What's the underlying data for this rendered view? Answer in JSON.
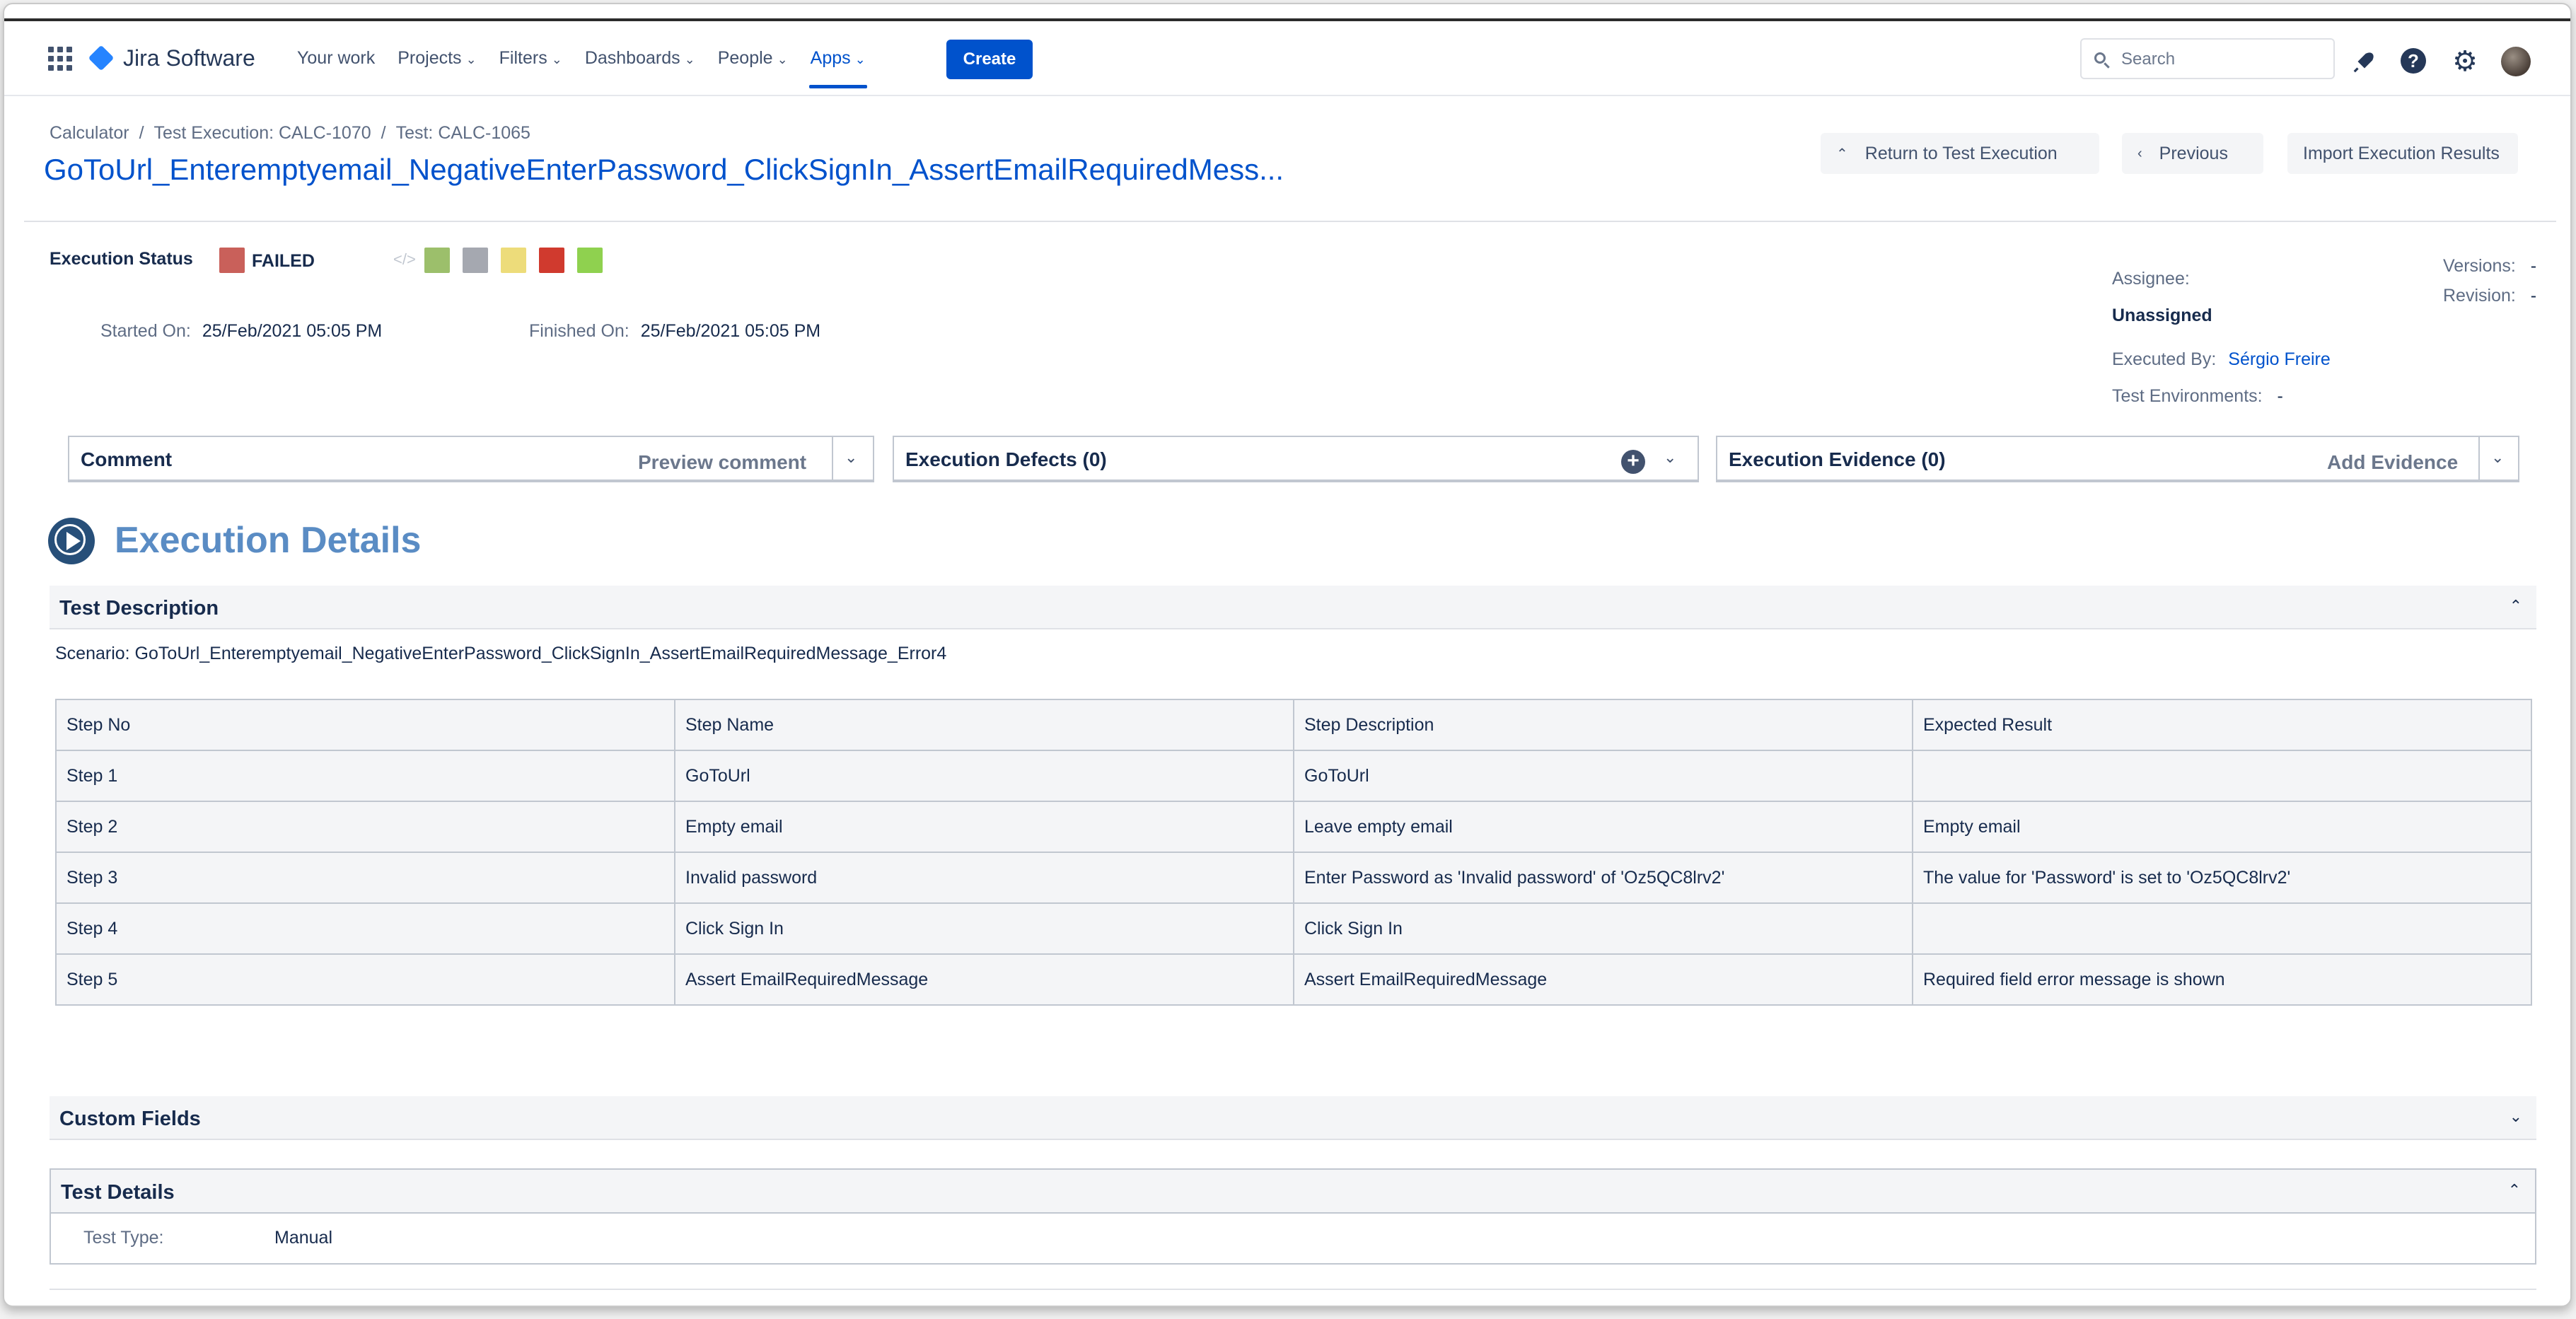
{
  "header": {
    "product_name": "Jira Software",
    "nav": [
      {
        "label": "Your work",
        "dropdown": false,
        "active": false
      },
      {
        "label": "Projects",
        "dropdown": true,
        "active": false
      },
      {
        "label": "Filters",
        "dropdown": true,
        "active": false
      },
      {
        "label": "Dashboards",
        "dropdown": true,
        "active": false
      },
      {
        "label": "People",
        "dropdown": true,
        "active": false
      },
      {
        "label": "Apps",
        "dropdown": true,
        "active": true
      }
    ],
    "create_label": "Create",
    "search_placeholder": "Search",
    "icons": [
      "apps-grid-icon",
      "bell-icon",
      "help-icon",
      "gear-icon",
      "avatar"
    ]
  },
  "breadcrumb": [
    "Calculator",
    "Test Execution: CALC-1070",
    "Test: CALC-1065"
  ],
  "page_title": "GoToUrl_Enteremptyemail_NegativeEnterPassword_ClickSignIn_AssertEmailRequiredMess...",
  "actions": {
    "return_label": "Return to Test Execution",
    "previous_label": "Previous",
    "import_label": "Import Execution Results"
  },
  "execution": {
    "status_label": "Execution Status",
    "status_value": "FAILED",
    "status_color": "#c9605a",
    "step_colors": [
      "#9cbf6b",
      "#a5a8b0",
      "#eddc7a",
      "#d03a2e",
      "#8fd14f"
    ],
    "started_label": "Started On:",
    "started_value": "25/Feb/2021 05:05 PM",
    "finished_label": "Finished On:",
    "finished_value": "25/Feb/2021 05:05 PM"
  },
  "people": {
    "assignee_label": "Assignee:",
    "assignee_value": "Unassigned",
    "executed_by_label": "Executed By:",
    "executed_by_value": "Sérgio Freire",
    "test_env_label": "Test Environments:",
    "test_env_value": "-",
    "versions_label": "Versions:",
    "versions_value": "-",
    "revision_label": "Revision:",
    "revision_value": "-"
  },
  "panels": {
    "comment_title": "Comment",
    "comment_action": "Preview comment",
    "defects_title": "Execution Defects (0)",
    "evidence_title": "Execution Evidence (0)",
    "evidence_action": "Add Evidence"
  },
  "details": {
    "title": "Execution Details",
    "test_description_title": "Test Description",
    "scenario": "Scenario: GoToUrl_Enteremptyemail_NegativeEnterPassword_ClickSignIn_AssertEmailRequiredMessage_Error4",
    "table": {
      "headers": [
        "Step No",
        "Step Name",
        "Step Description",
        "Expected Result"
      ],
      "rows": [
        [
          "Step 1",
          "GoToUrl",
          "GoToUrl",
          ""
        ],
        [
          "Step 2",
          "Empty email",
          "Leave empty email",
          "Empty email"
        ],
        [
          "Step 3",
          "Invalid password",
          "Enter Password as 'Invalid password' of 'Oz5QC8lrv2'",
          "The value for 'Password' is set to 'Oz5QC8lrv2'"
        ],
        [
          "Step 4",
          "Click Sign In",
          "Click Sign In",
          ""
        ],
        [
          "Step 5",
          "Assert EmailRequiredMessage",
          "Assert EmailRequiredMessage",
          "Required field error message is shown"
        ]
      ]
    },
    "custom_fields_title": "Custom Fields",
    "test_details_title": "Test Details",
    "test_type_label": "Test Type:",
    "test_type_value": "Manual"
  }
}
